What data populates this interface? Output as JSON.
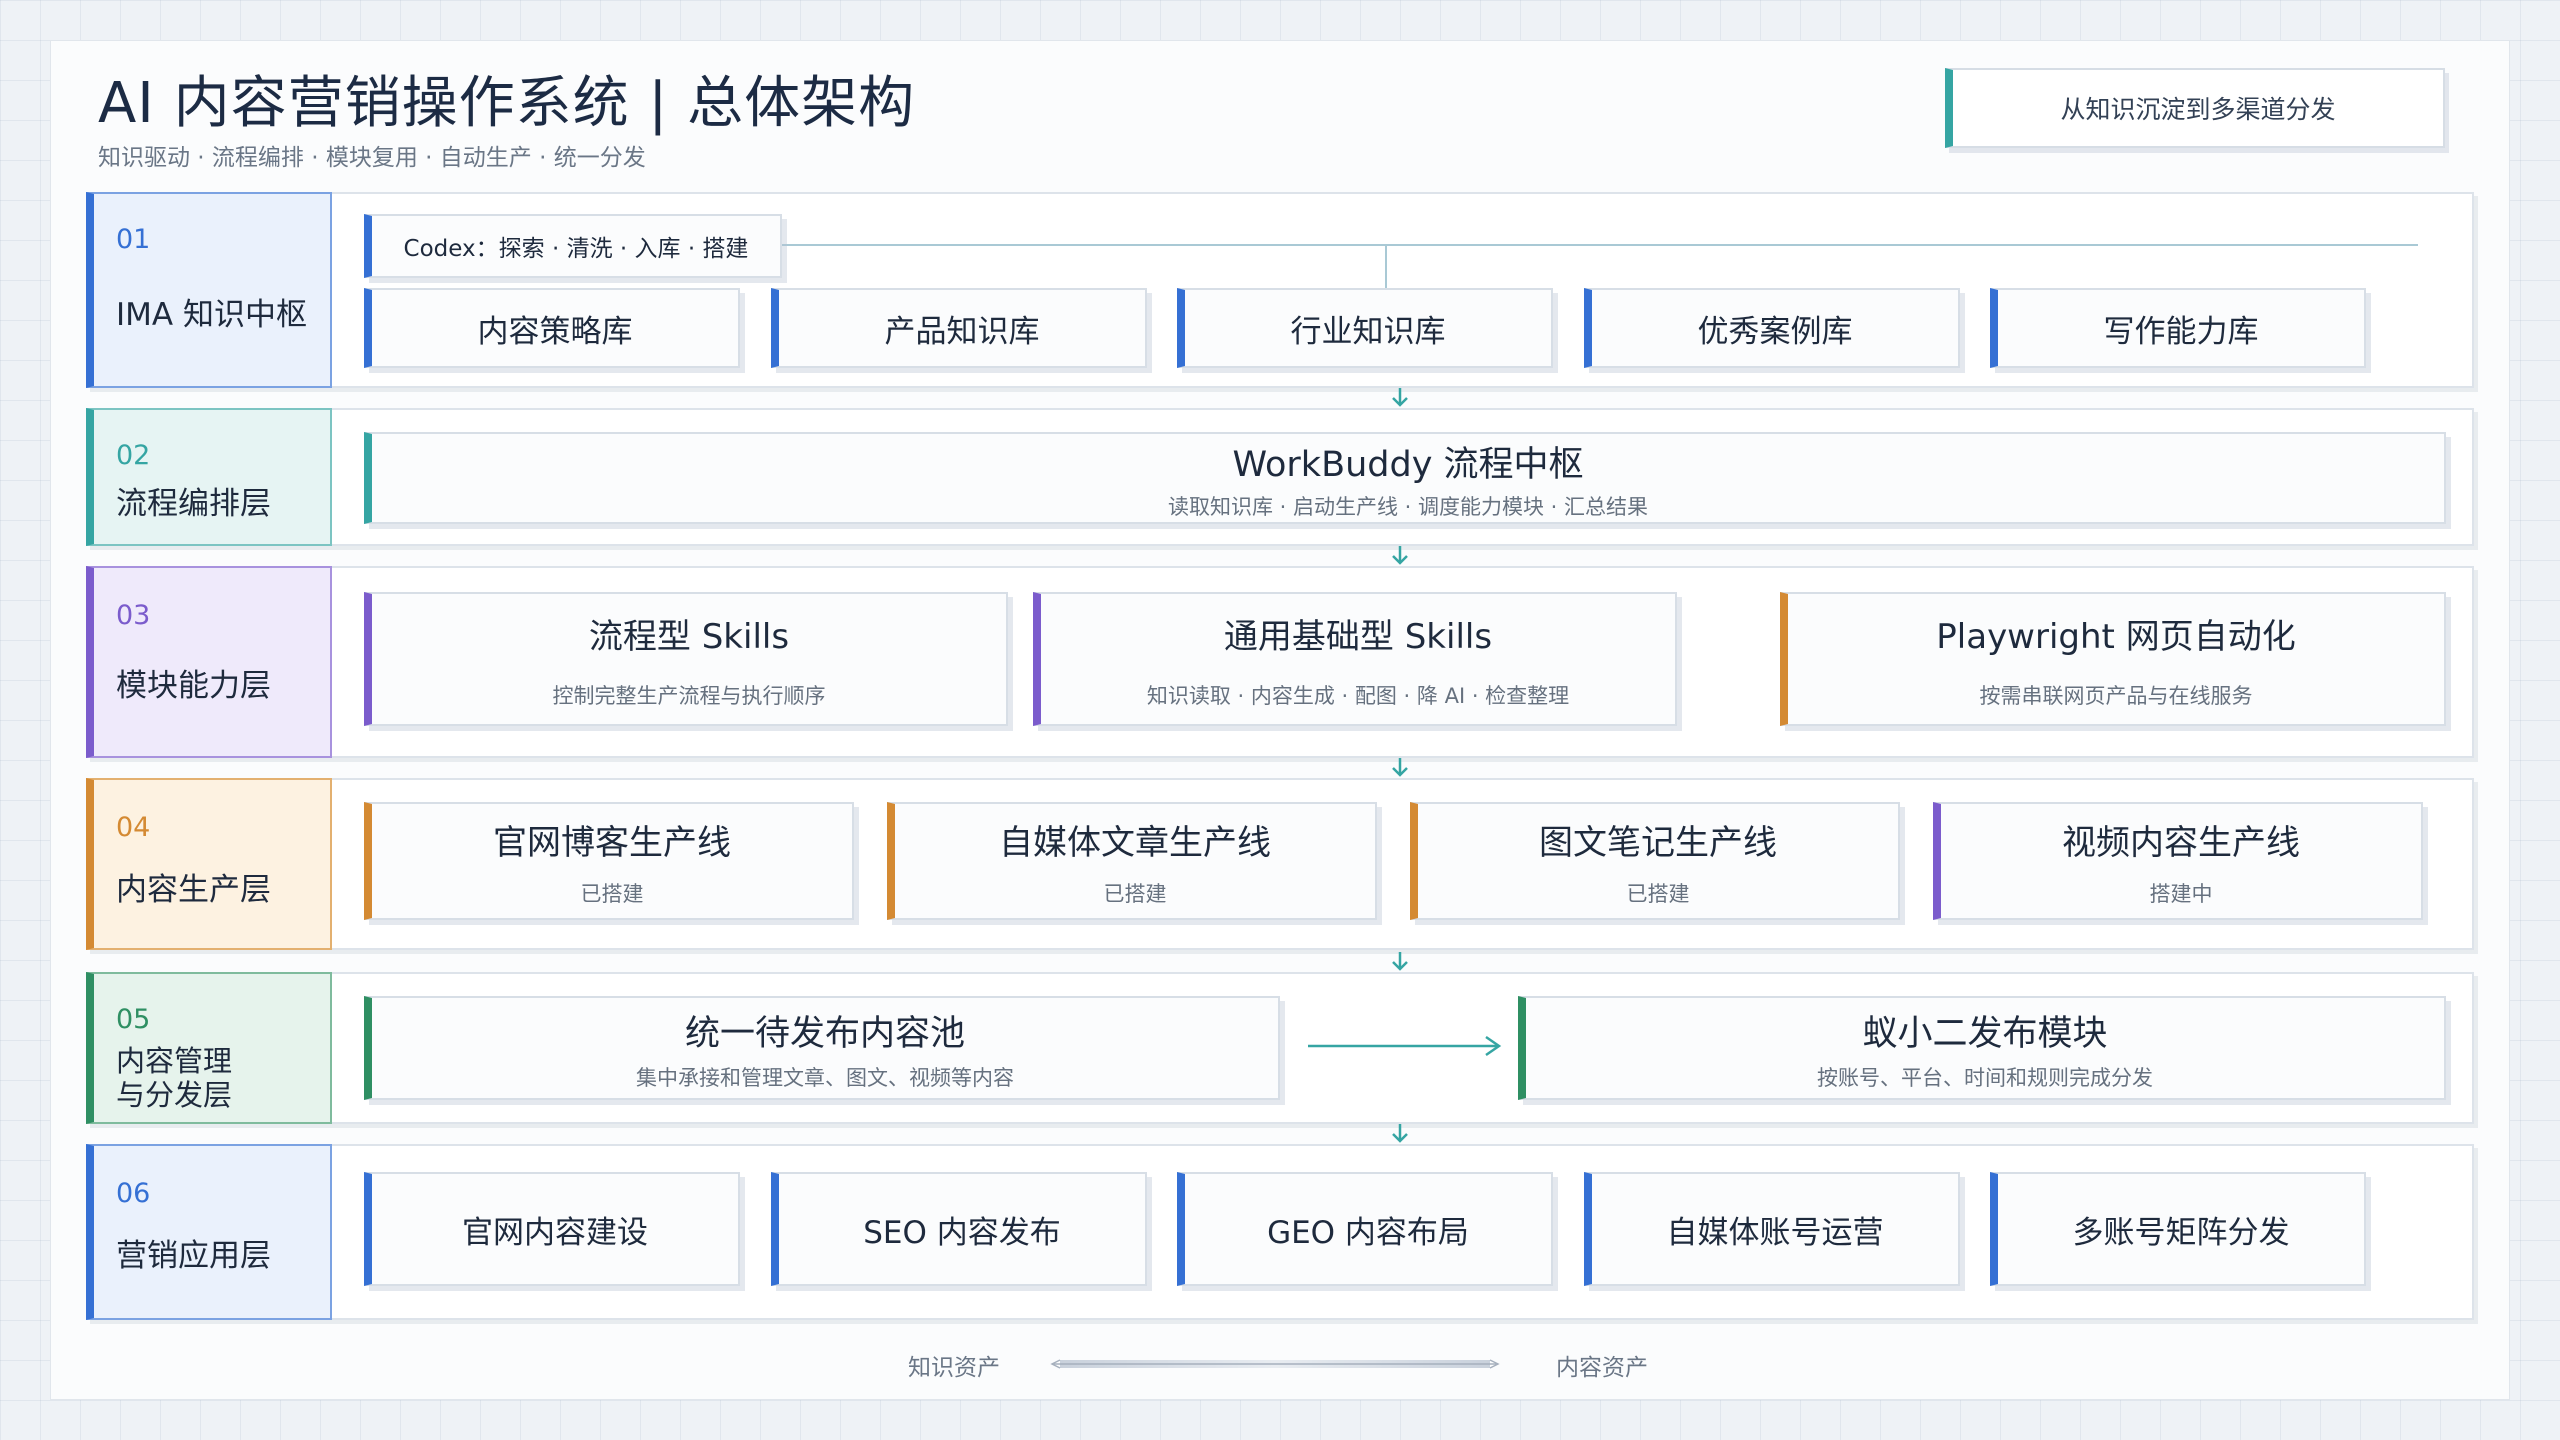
{
  "header": {
    "title": "AI 内容营销操作系统 | 总体架构",
    "subtitle": "知识驱动 · 流程编排 · 模块复用 · 自动生产 · 统一分发",
    "tag": "从知识沉淀到多渠道分发"
  },
  "colors": {
    "blue": "#3570d4",
    "teal": "#35a5a3",
    "purple": "#7b5ccc",
    "orange": "#d48a33",
    "green": "#2f8f63",
    "arrow": "#35a5a3"
  },
  "layers": [
    {
      "num": "01",
      "name": "IMA 知识中枢",
      "codex": "Codex：探索 · 清洗 · 入库 · 搭建",
      "items": [
        "内容策略库",
        "产品知识库",
        "行业知识库",
        "优秀案例库",
        "写作能力库"
      ]
    },
    {
      "num": "02",
      "name": "流程编排层",
      "hub_title": "WorkBuddy 流程中枢",
      "hub_sub": "读取知识库 · 启动生产线 · 调度能力模块 · 汇总结果"
    },
    {
      "num": "03",
      "name": "模块能力层",
      "items": [
        {
          "title": "流程型 Skills",
          "sub": "控制完整生产流程与执行顺序"
        },
        {
          "title": "通用基础型 Skills",
          "sub": "知识读取 · 内容生成 · 配图 · 降 AI · 检查整理"
        },
        {
          "title": "Playwright 网页自动化",
          "sub": "按需串联网页产品与在线服务"
        }
      ]
    },
    {
      "num": "04",
      "name": "内容生产层",
      "items": [
        {
          "title": "官网博客生产线",
          "sub": "已搭建"
        },
        {
          "title": "自媒体文章生产线",
          "sub": "已搭建"
        },
        {
          "title": "图文笔记生产线",
          "sub": "已搭建"
        },
        {
          "title": "视频内容生产线",
          "sub": "搭建中"
        }
      ]
    },
    {
      "num": "05",
      "name_line1": "内容管理",
      "name_line2": "与分发层",
      "items": [
        {
          "title": "统一待发布内容池",
          "sub": "集中承接和管理文章、图文、视频等内容"
        },
        {
          "title": "蚁小二发布模块",
          "sub": "按账号、平台、时间和规则完成分发"
        }
      ]
    },
    {
      "num": "06",
      "name": "营销应用层",
      "items": [
        "官网内容建设",
        "SEO 内容发布",
        "GEO 内容布局",
        "自媒体账号运营",
        "多账号矩阵分发"
      ]
    }
  ],
  "footer": {
    "left": "知识资产",
    "right": "内容资产"
  }
}
